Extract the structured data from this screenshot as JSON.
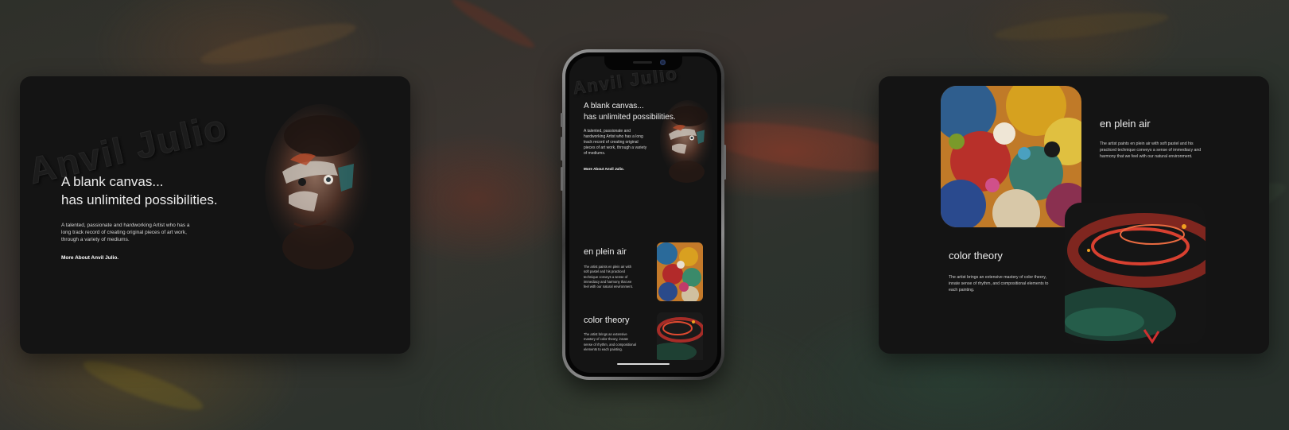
{
  "hero": {
    "watermark": "Anvil Julio",
    "title_line1": "A blank canvas...",
    "title_line2": "has unlimited possibilities.",
    "description": "A talented, passionate and hardworking Artist who has a long track record of creating original pieces of art work, through a variety of mediums.",
    "link_label": "More About Anvil Julio."
  },
  "sections": {
    "plein_air": {
      "title": "en plein air",
      "description": "The artist paints en plein air with soft pastel and his practiced technique conveys a sense of immediacy and harmony that we feel with our natural environment."
    },
    "color_theory": {
      "title": "color theory",
      "description": "The artist brings an extensive mastery of color theory, innate sense of rhythm, and compositional elements to each painting."
    }
  },
  "images": {
    "portrait": "painted-portrait-image",
    "plein_air": "abstract-palette-painting-image",
    "color_theory": "red-green-abstract-painting-image"
  },
  "colors": {
    "card_background": "#141414",
    "page_background": "#2e302a",
    "text_primary": "#ececec",
    "phone_frame": "#8a8a8a"
  }
}
